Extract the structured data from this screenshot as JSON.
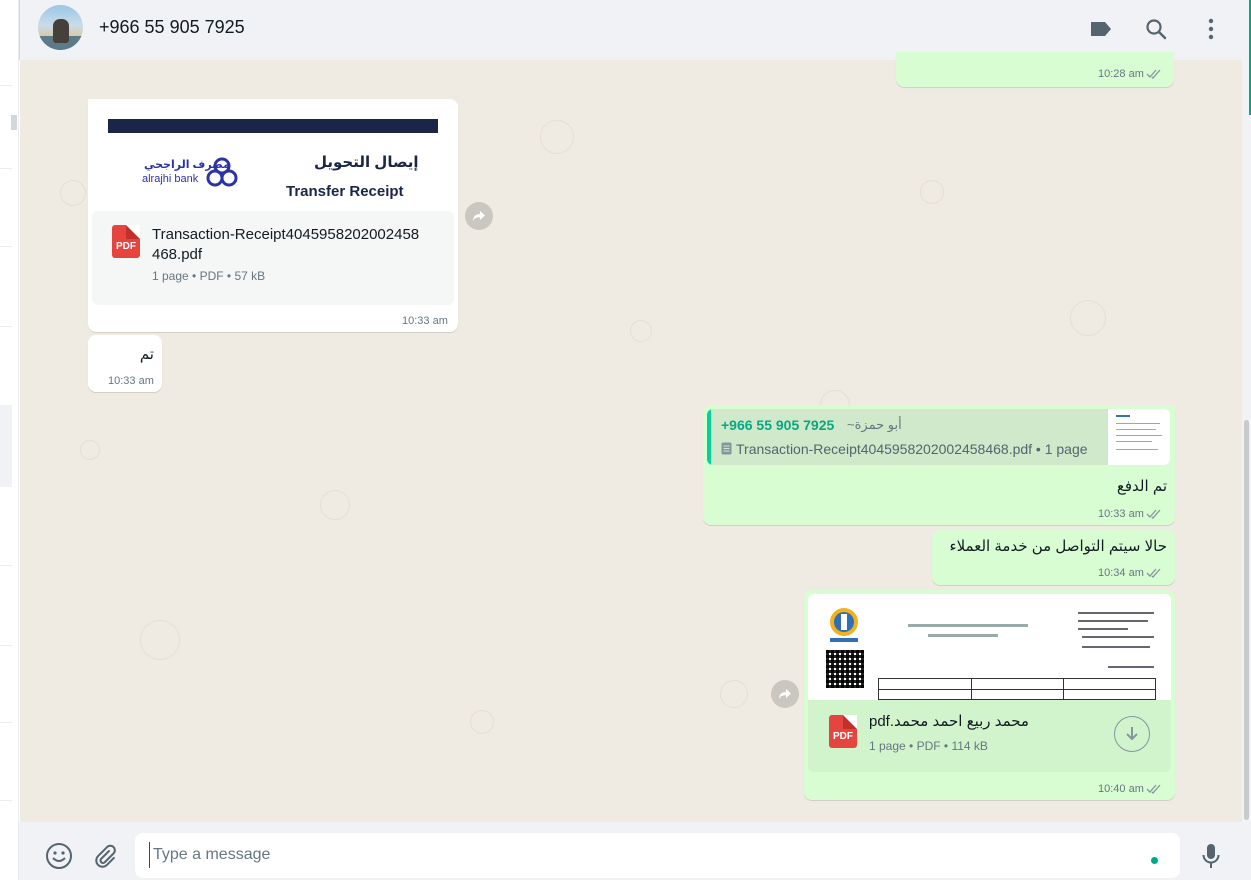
{
  "header": {
    "contact_name": "+966 55 905 7925",
    "icons": [
      "label-icon",
      "search-icon",
      "menu-icon"
    ]
  },
  "messages": [
    {
      "id": "m1",
      "direction": "outgoing",
      "time": "10:28 am",
      "status": "read"
    },
    {
      "id": "m2",
      "direction": "incoming",
      "type": "document",
      "preview": {
        "title_ar": "إيصال التحويل",
        "title_en": "Transfer Receipt",
        "bank_ar": "مصرف الراجحي",
        "bank_en": "alrajhi bank"
      },
      "file_name_line1": "Transaction-Receipt4045958202002458",
      "file_name_line2": "468.pdf",
      "meta": "1 page • PDF • 57 kB",
      "time": "10:33 am"
    },
    {
      "id": "m3",
      "direction": "incoming",
      "text": "تم",
      "time": "10:33 am"
    },
    {
      "id": "m4",
      "direction": "outgoing",
      "quote": {
        "sender": "+966 55 905 7925",
        "alias": "~أبو حمزة",
        "doc": "Transaction-Receipt4045958202002458468.pdf • 1 page"
      },
      "text": "تم الدفع",
      "time": "10:33 am",
      "status": "read"
    },
    {
      "id": "m5",
      "direction": "outgoing",
      "text": "حالا سيتم التواصل من خدمة العملاء",
      "time": "10:34 am",
      "status": "read"
    },
    {
      "id": "m6",
      "direction": "outgoing",
      "type": "document",
      "file_name": "محمد ربيع احمد محمد.pdf",
      "meta": "1 page • PDF • 114 kB",
      "time": "10:40 am",
      "status": "read"
    }
  ],
  "composer": {
    "placeholder": "Type a message",
    "value": ""
  },
  "colors": {
    "outgoing_bubble": "#d9fdd3",
    "incoming_bubble": "#ffffff",
    "chat_background": "#efeae2",
    "accent": "#00a884",
    "read_tick": "#53bdeb"
  }
}
